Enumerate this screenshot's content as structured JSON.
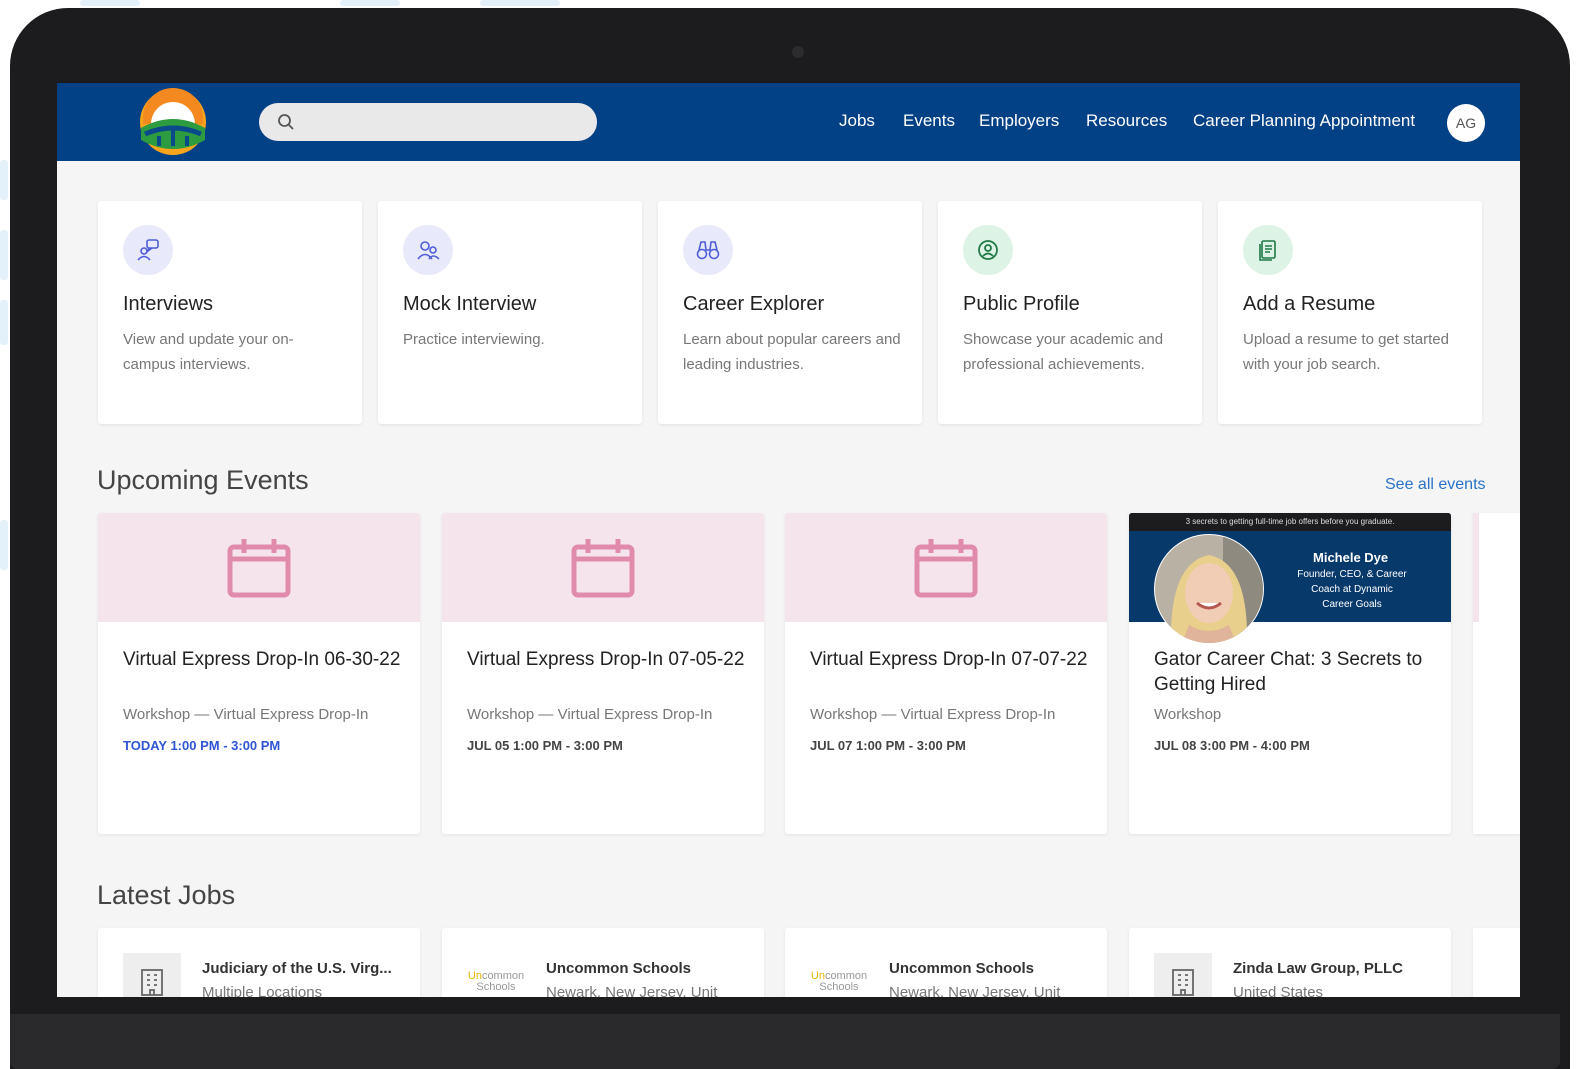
{
  "header": {
    "nav": [
      "Jobs",
      "Events",
      "Employers",
      "Resources",
      "Career Planning Appointment"
    ],
    "avatar_initials": "AG",
    "search_placeholder": ""
  },
  "quick_links": [
    {
      "title": "Interviews",
      "description": "View and update your on-campus interviews.",
      "icon": "interview-icon",
      "color": "#e8eafc"
    },
    {
      "title": "Mock Interview",
      "description": "Practice interviewing.",
      "icon": "mock-interview-icon",
      "color": "#e8eafc"
    },
    {
      "title": "Career Explorer",
      "description": "Learn about popular careers and leading industries.",
      "icon": "binoculars-icon",
      "color": "#e8eafc"
    },
    {
      "title": "Public Profile",
      "description": "Showcase your academic and professional achievements.",
      "icon": "profile-icon",
      "color": "#dcf3e6"
    },
    {
      "title": "Add a Resume",
      "description": "Upload a resume to get started with your job search.",
      "icon": "resume-icon",
      "color": "#dcf3e6"
    }
  ],
  "events_section": {
    "title": "Upcoming Events",
    "see_all": "See all events",
    "events": [
      {
        "title": "Virtual Express Drop-In 06-30-22",
        "type": "Workshop — Virtual Express Drop-In",
        "time": "TODAY 1:00 PM - 3:00 PM"
      },
      {
        "title": "Virtual Express Drop-In 07-05-22",
        "type": "Workshop — Virtual Express Drop-In",
        "time": "JUL 05 1:00 PM - 3:00 PM"
      },
      {
        "title": "Virtual Express Drop-In 07-07-22",
        "type": "Workshop — Virtual Express Drop-In",
        "time": "JUL 07 1:00 PM - 3:00 PM"
      },
      {
        "title": "Gator Career Chat: 3 Secrets to Getting Hired",
        "type": "Workshop",
        "time": "JUL 08 3:00 PM - 4:00 PM",
        "banner": {
          "top_text": "3 secrets to getting full-time job offers before you graduate.",
          "name": "Michele Dye",
          "role": "Founder, CEO, & Career Coach at Dynamic Career Goals"
        }
      }
    ]
  },
  "jobs_section": {
    "title": "Latest Jobs",
    "jobs": [
      {
        "employer": "Judiciary of the U.S. Virg...",
        "location": "Multiple Locations"
      },
      {
        "employer": "Uncommon Schools",
        "location": "Newark, New Jersey, Unit"
      },
      {
        "employer": "Uncommon Schools",
        "location": "Newark, New Jersey, Unit"
      },
      {
        "employer": "Zinda Law Group, PLLC",
        "location": "United States"
      }
    ],
    "uncommon_logo": {
      "line1a": "Un",
      "line1b": "common",
      "line2": "Schools"
    }
  },
  "colors": {
    "nav": "#034186",
    "accent_link": "#2a73c8",
    "today": "#2f55d4",
    "event_banner": "#f6e4ec",
    "calendar": "#e08bab"
  }
}
